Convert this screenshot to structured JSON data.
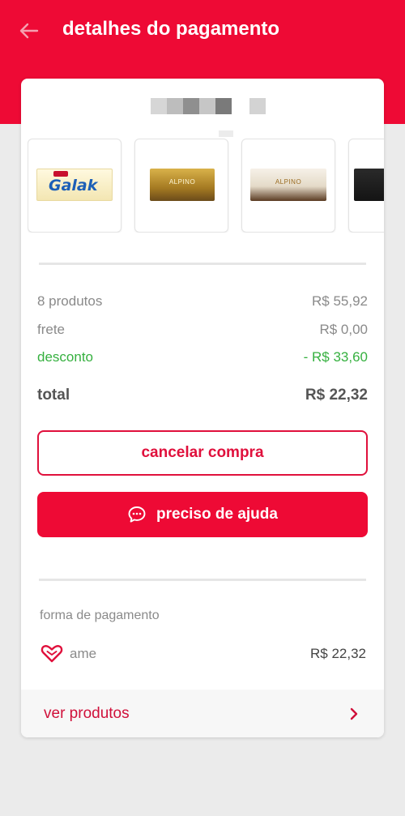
{
  "header": {
    "title": "detalhes do pagamento"
  },
  "colors": {
    "brand_red": "#ee0a35",
    "discount_green": "#35b03f"
  },
  "products": [
    {
      "name": "galak",
      "brand_text": "Galak"
    },
    {
      "name": "alpino-gold",
      "brand_text": "ALPINO"
    },
    {
      "name": "alpino-white",
      "brand_text": "ALPINO"
    },
    {
      "name": "dark-chocolate",
      "brand_text": ""
    }
  ],
  "summary": {
    "products_label": "8 produtos",
    "products_value": "R$ 55,92",
    "shipping_label": "frete",
    "shipping_value": "R$ 0,00",
    "discount_label": "desconto",
    "discount_value": "- R$ 33,60",
    "total_label": "total",
    "total_value": "R$ 22,32"
  },
  "actions": {
    "cancel_label": "cancelar compra",
    "help_label": "preciso de ajuda"
  },
  "payment": {
    "section_label": "forma de pagamento",
    "method_label": "ame",
    "method_value": "R$ 22,32"
  },
  "footer": {
    "label": "ver produtos"
  }
}
